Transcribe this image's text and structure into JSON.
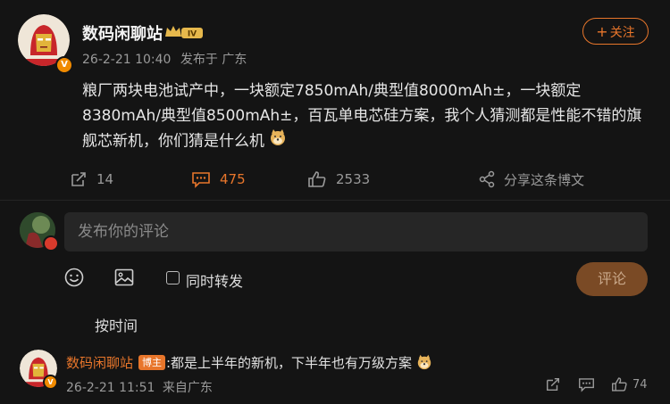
{
  "post": {
    "author": "数码闲聊站",
    "level_badge": "IV",
    "timestamp": "26-2-21 10:40",
    "source": "发布于 广东",
    "follow_label": "关注",
    "content": "粮厂两块电池试产中，一块额定7850mAh/典型值8000mAh±，一块额定8380mAh/典型值8500mAh±，百瓦单电芯硅方案，我个人猜测都是性能不错的旗舰芯新机，你们猜是什么机",
    "actions": {
      "repost_count": "14",
      "comment_count": "475",
      "like_count": "2533",
      "share_label": "分享这条博文"
    }
  },
  "composer": {
    "placeholder": "发布你的评论",
    "repost_label": "同时转发",
    "submit_label": "评论"
  },
  "sort_label": "按时间",
  "reply": {
    "author": "数码闲聊站",
    "badge": "博主",
    "text": ":都是上半年的新机，下半年也有万级方案",
    "timestamp": "26-2-21 11:51",
    "source": "来自广东",
    "like_count": "74"
  },
  "colors": {
    "background": "#141414",
    "accent": "#e8762b",
    "muted": "#9a9a9a"
  },
  "icons": [
    "repost-icon",
    "comment-icon",
    "like-icon",
    "share-icon",
    "emoji-icon",
    "image-icon",
    "doge-emoji"
  ]
}
